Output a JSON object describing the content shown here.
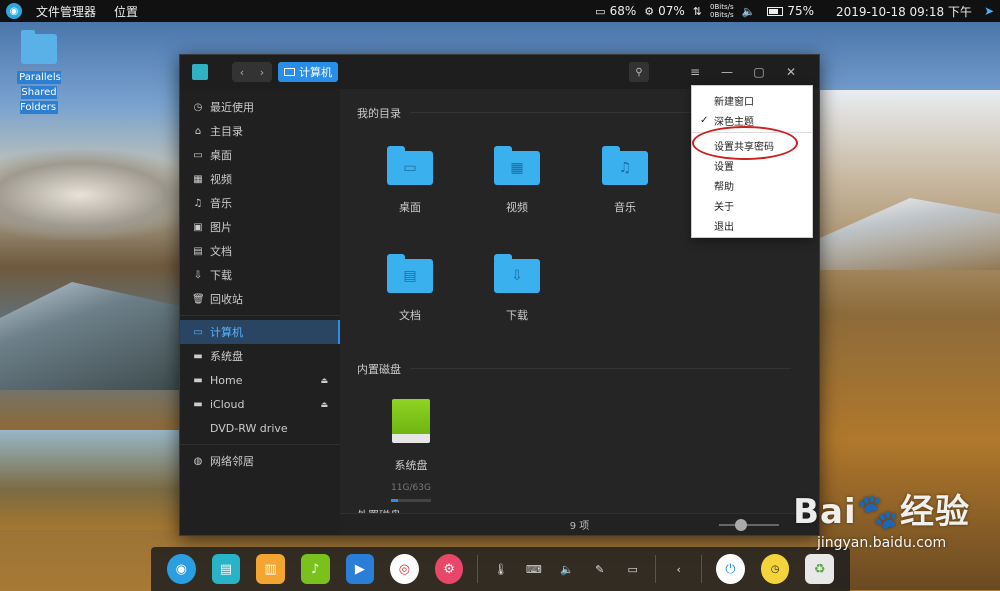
{
  "topbar": {
    "app_name": "文件管理器",
    "menu_location": "位置",
    "disk_percent": "68%",
    "cpu_percent": "07%",
    "net_up": "0Bits/s",
    "net_down": "0Bits/s",
    "battery_percent": "75%",
    "datetime": "2019-10-18 09:18 下午"
  },
  "desktop": {
    "icon_label_line1": "Parallels Shared",
    "icon_label_line2": "Folders"
  },
  "window": {
    "breadcrumb": "计算机",
    "sidebar": [
      {
        "label": "最近使用",
        "icon": "clock-icon"
      },
      {
        "label": "主目录",
        "icon": "home-icon"
      },
      {
        "label": "桌面",
        "icon": "desktop-icon"
      },
      {
        "label": "视频",
        "icon": "video-icon"
      },
      {
        "label": "音乐",
        "icon": "music-icon"
      },
      {
        "label": "图片",
        "icon": "image-icon"
      },
      {
        "label": "文档",
        "icon": "document-icon"
      },
      {
        "label": "下载",
        "icon": "download-icon"
      },
      {
        "label": "回收站",
        "icon": "trash-icon"
      },
      {
        "label": "计算机",
        "icon": "computer-icon"
      },
      {
        "label": "系统盘",
        "icon": "disk-icon"
      },
      {
        "label": "Home",
        "icon": "disk-icon"
      },
      {
        "label": "iCloud",
        "icon": "disk-icon"
      },
      {
        "label": "DVD-RW drive",
        "icon": ""
      },
      {
        "label": "网络邻居",
        "icon": "network-icon"
      }
    ],
    "sections": {
      "my_dirs": "我的目录",
      "internal_disks": "内置磁盘",
      "external_disks": "外置磁盘"
    },
    "folders": [
      "桌面",
      "视频",
      "音乐",
      "文档",
      "下载"
    ],
    "disk": {
      "label": "系统盘",
      "usage": "11G/63G",
      "used_fraction": 0.17
    },
    "status": "9 项"
  },
  "menu": {
    "items": [
      "新建窗口",
      "深色主题",
      "设置共享密码",
      "设置",
      "帮助",
      "关于",
      "退出"
    ]
  },
  "watermark": {
    "url": "jingyan.baidu.com"
  }
}
